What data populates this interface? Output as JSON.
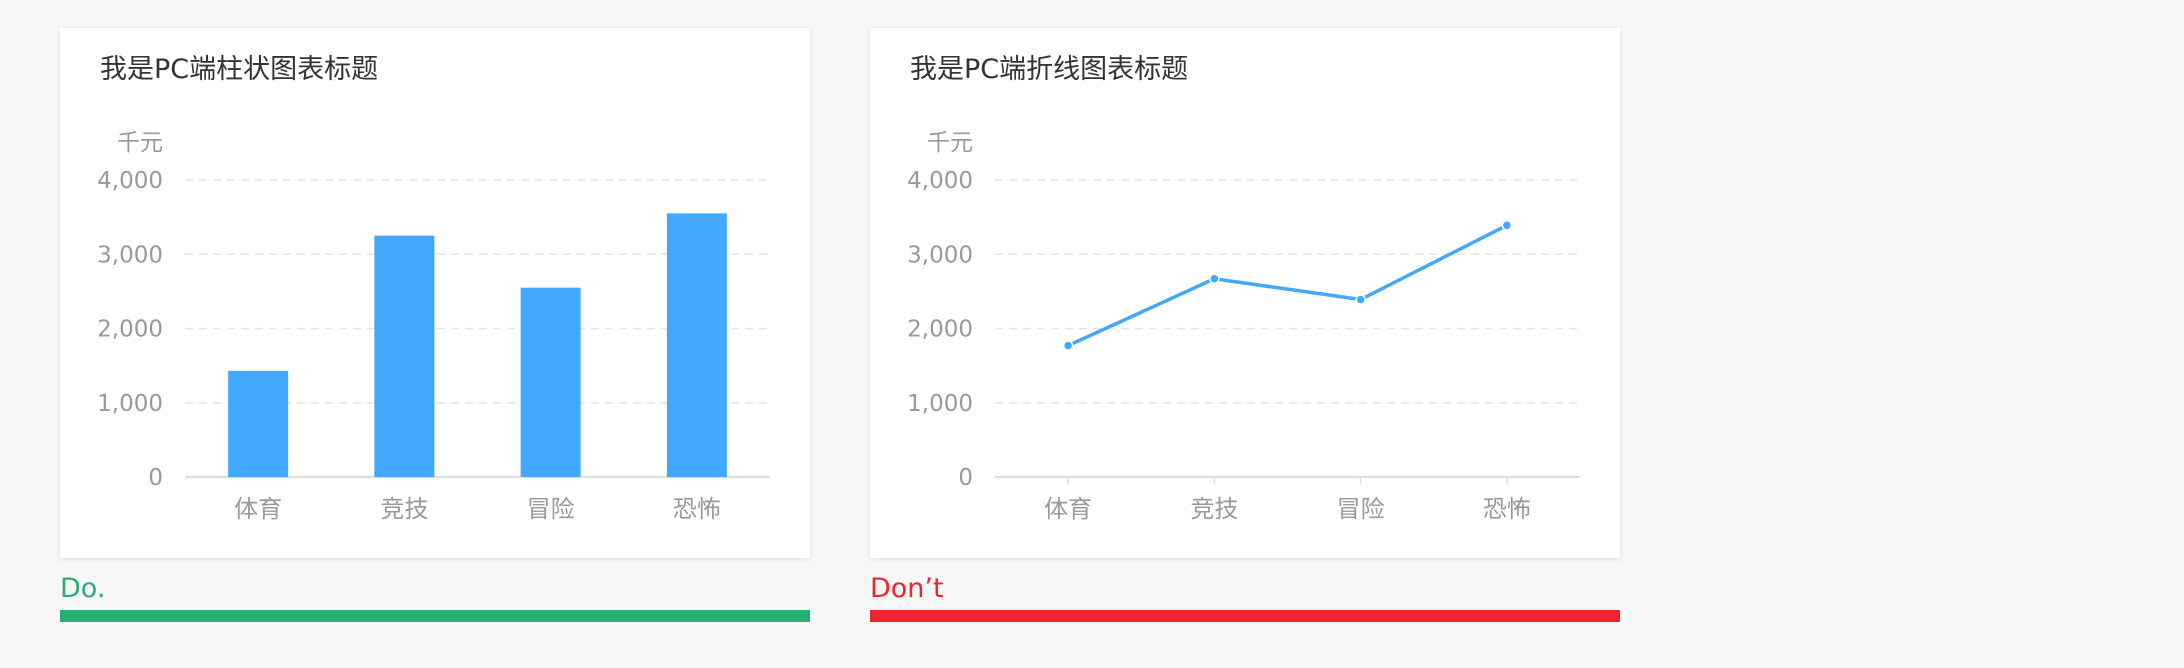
{
  "panels": {
    "good": {
      "verdict": "Do.",
      "color": "#27ae73"
    },
    "bad": {
      "verdict": "Don’t",
      "color": "#ee2430"
    }
  },
  "chart_data": [
    {
      "type": "bar",
      "title": "我是PC端柱状图表标题",
      "ylabel": "千元",
      "categories": [
        "体育",
        "竞技",
        "冒险",
        "恐怖"
      ],
      "values": [
        1430,
        3250,
        2550,
        3550
      ],
      "ylim": [
        0,
        4000
      ],
      "yticks": [
        "0",
        "1,000",
        "2,000",
        "3,000",
        "4,000"
      ],
      "grid": true,
      "color": "#42a8fd"
    },
    {
      "type": "line",
      "title": "我是PC端折线图表标题",
      "ylabel": "千元",
      "categories": [
        "体育",
        "竞技",
        "冒险",
        "恐怖"
      ],
      "values": [
        1770,
        2670,
        2390,
        3390
      ],
      "ylim": [
        0,
        4000
      ],
      "yticks": [
        "0",
        "1,000",
        "2,000",
        "3,000",
        "4,000"
      ],
      "grid": true,
      "color": "#42a8fd"
    }
  ]
}
